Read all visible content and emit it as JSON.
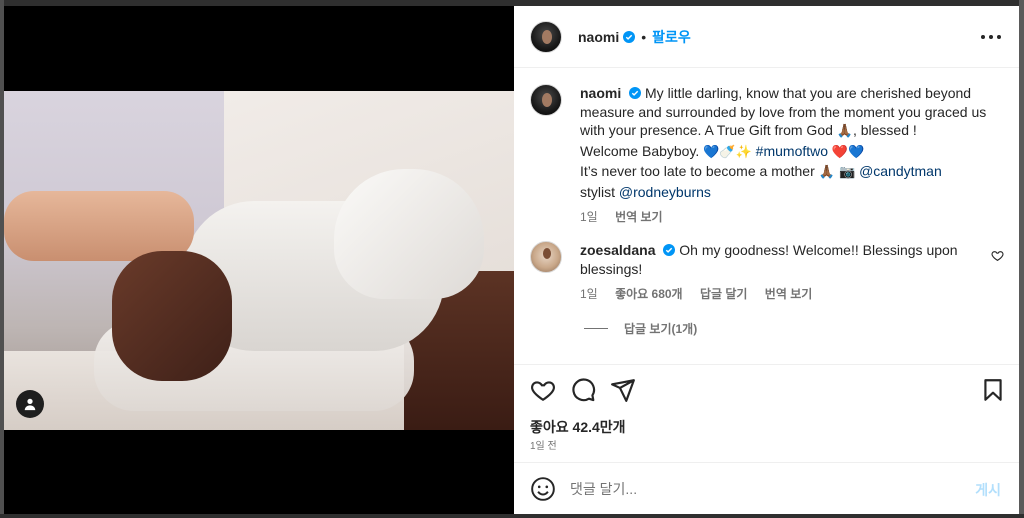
{
  "post": {
    "username": "naomi",
    "follow_label": "팔로우",
    "more_icon": "more-horizontal-icon",
    "caption": {
      "line1": "My little darling, know that you are cherished beyond",
      "line2": "measure and surrounded by love from the moment you graced",
      "line3_a": "us with your presence. A True Gift from God",
      "line3_emoji": "🙏🏾",
      "line3_b": ", blessed !",
      "line4_a": "Welcome Babyboy.",
      "line4_emoji": "💙🍼✨",
      "hashtag": "#mumoftwo",
      "line4_emoji2": "❤️💙",
      "line5_a": "It’s never too late to become a mother",
      "line5_emoji": "🙏🏾 📷",
      "mention1": "@candytman",
      "line6_a": "stylist",
      "mention2": "@rodneyburns",
      "time": "1일",
      "translate": "번역 보기"
    }
  },
  "comment": {
    "username": "zoesaldana",
    "text_a": "Oh my goodness! Welcome!! Blessings upon",
    "text_b": "blessings!",
    "time": "1일",
    "likes": "좋아요 680개",
    "reply": "답글 달기",
    "translate": "번역 보기",
    "view_replies": "답글 보기(1개)"
  },
  "actions": {
    "like_icon": "heart-icon",
    "comment_icon": "comment-icon",
    "share_icon": "send-icon",
    "save_icon": "bookmark-icon",
    "likes_count": "좋아요 42.4만개",
    "posted_ago": "1일 전"
  },
  "composer": {
    "placeholder": "댓글 달기...",
    "post_label": "게시",
    "emoji_icon": "smiley-icon"
  },
  "colors": {
    "accent": "#0095f6",
    "post_disabled": "#b2dffc",
    "text_primary": "#262626",
    "text_secondary": "#737373"
  }
}
